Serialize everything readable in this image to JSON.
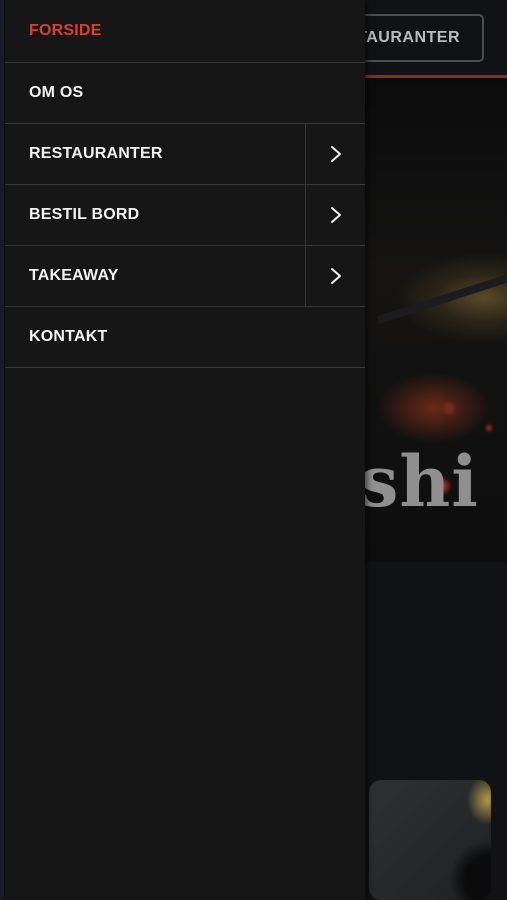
{
  "header": {
    "restaurants_button_label": "TAURANTER"
  },
  "hero": {
    "title_fragment": "shi"
  },
  "menu": {
    "items": [
      {
        "label": "FORSIDE",
        "active": true,
        "has_submenu": false
      },
      {
        "label": "OM OS",
        "active": false,
        "has_submenu": false
      },
      {
        "label": "RESTAURANTER",
        "active": false,
        "has_submenu": true
      },
      {
        "label": "BESTIL BORD",
        "active": false,
        "has_submenu": true
      },
      {
        "label": "TAKEAWAY",
        "active": false,
        "has_submenu": true
      },
      {
        "label": "KONTAKT",
        "active": false,
        "has_submenu": false
      }
    ]
  },
  "colors": {
    "active": "#d9412e",
    "drawer_bg": "#161616",
    "text": "#f2f2f2",
    "divider": "#363636"
  }
}
